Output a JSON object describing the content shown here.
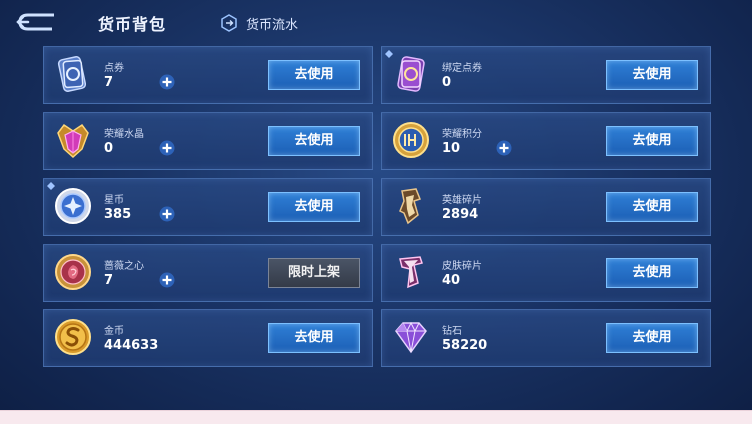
{
  "header": {
    "title": "货币背包",
    "flow_tab": "货币流水"
  },
  "cards": [
    {
      "name": "点券",
      "amount": "7",
      "action": "去使用",
      "has_plus": true,
      "icon": "ticket-icon"
    },
    {
      "name": "绑定点券",
      "amount": "0",
      "action": "去使用",
      "has_plus": false,
      "icon": "bound-ticket-icon"
    },
    {
      "name": "荣耀水晶",
      "amount": "0",
      "action": "去使用",
      "has_plus": true,
      "icon": "glory-crystal-icon"
    },
    {
      "name": "荣耀积分",
      "amount": "10",
      "action": "去使用",
      "has_plus": true,
      "icon": "glory-points-icon"
    },
    {
      "name": "星币",
      "amount": "385",
      "action": "去使用",
      "has_plus": true,
      "icon": "star-coin-icon"
    },
    {
      "name": "英雄碎片",
      "amount": "2894",
      "action": "去使用",
      "has_plus": false,
      "icon": "hero-fragment-icon"
    },
    {
      "name": "蔷薇之心",
      "amount": "7",
      "action": "限时上架",
      "has_plus": true,
      "icon": "rose-heart-icon"
    },
    {
      "name": "皮肤碎片",
      "amount": "40",
      "action": "去使用",
      "has_plus": false,
      "icon": "skin-fragment-icon"
    },
    {
      "name": "金币",
      "amount": "444633",
      "action": "去使用",
      "has_plus": false,
      "icon": "gold-coin-icon"
    },
    {
      "name": "钻石",
      "amount": "58220",
      "action": "去使用",
      "has_plus": false,
      "icon": "diamond-icon"
    }
  ],
  "colors": {
    "accent": "#2f7fd6",
    "card_border": "#6ea0e6",
    "gold": "#e8b64a"
  }
}
